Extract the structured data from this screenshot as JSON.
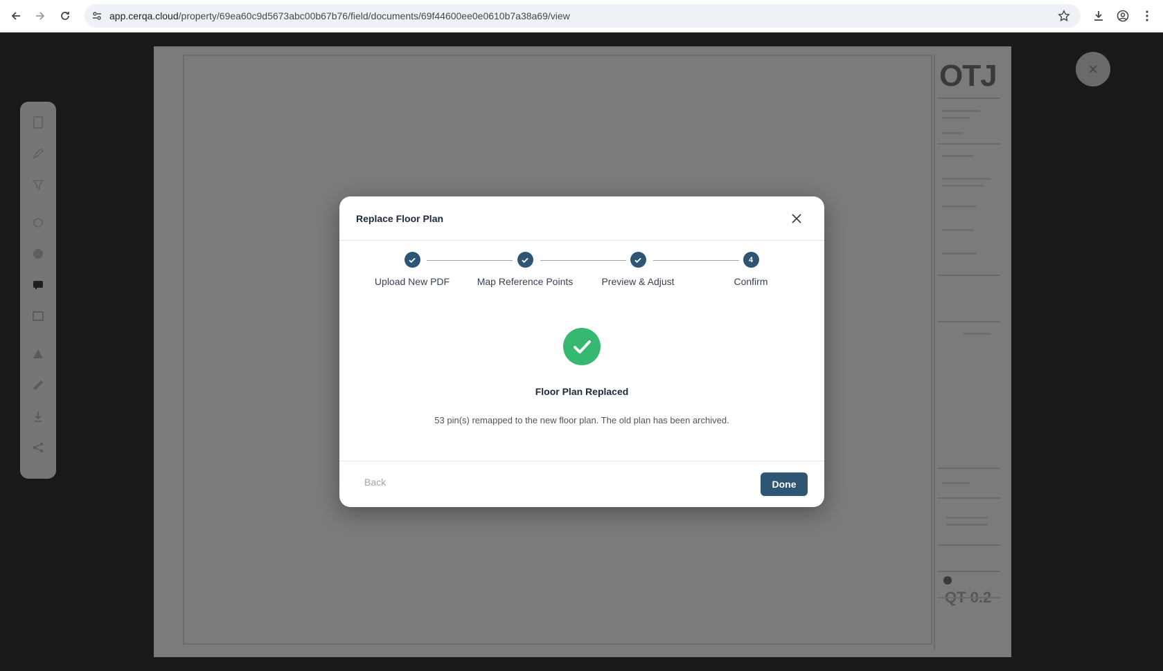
{
  "browser": {
    "url_host": "app.cerqa.cloud",
    "url_path": "/property/69ea60c9d5673abc00b67b76/field/documents/69f44600ee0e0610b7a38a69/view"
  },
  "document": {
    "logo": "OTJ",
    "sheet_code": "QT 0.2"
  },
  "modal": {
    "title": "Replace Floor Plan",
    "steps": [
      {
        "label": "Upload New PDF",
        "state": "complete"
      },
      {
        "label": "Map Reference Points",
        "state": "complete"
      },
      {
        "label": "Preview & Adjust",
        "state": "complete"
      },
      {
        "label": "Confirm",
        "state": "current",
        "number": "4"
      }
    ],
    "success_title": "Floor Plan Replaced",
    "success_message": "53 pin(s) remapped to the new floor plan. The old plan has been archived.",
    "back_label": "Back",
    "done_label": "Done"
  },
  "colors": {
    "primary": "#2f5575",
    "success": "#37b870"
  }
}
